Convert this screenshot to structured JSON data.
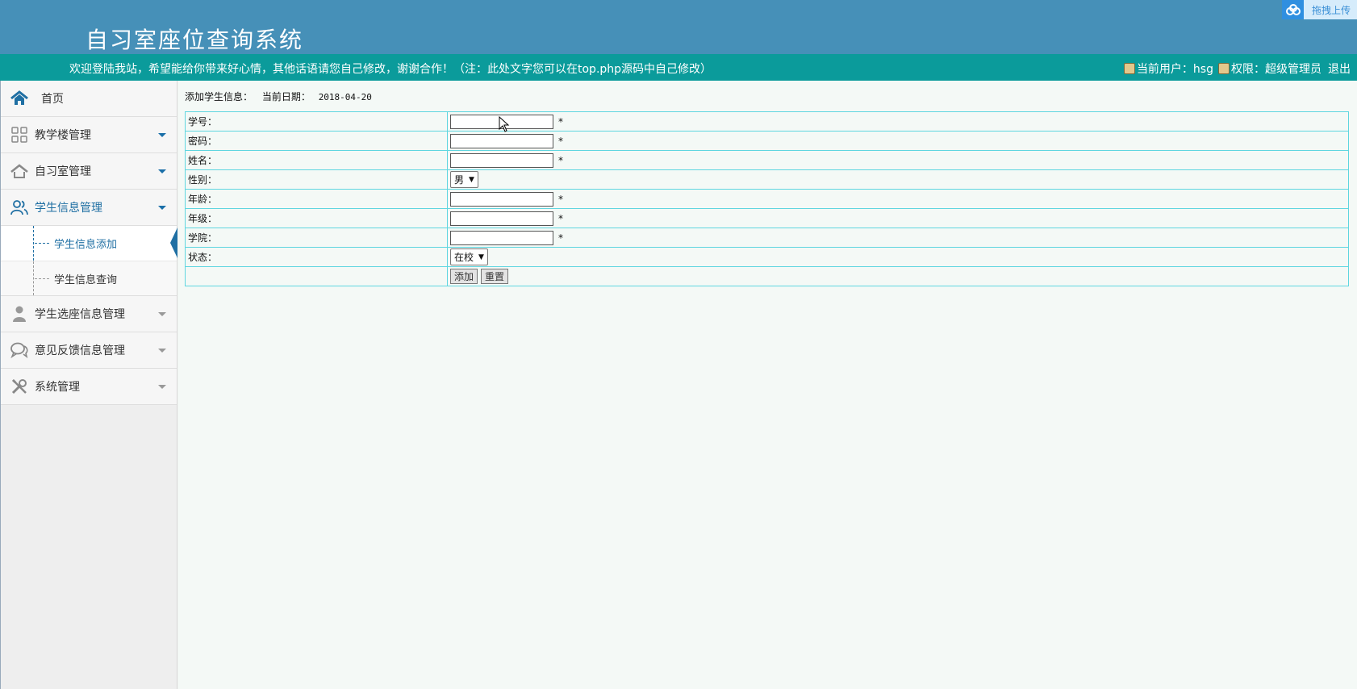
{
  "header": {
    "title": "自习室座位查询系统",
    "upload_label": "拖拽上传",
    "welcome": "欢迎登陆我站，希望能给你带来好心情，其他话语请您自己修改，谢谢合作！（注：此处文字您可以在top.php源码中自己修改）",
    "current_user_label": "当前用户：hsg",
    "role_label": "权限：超级管理员",
    "logout_label": "退出"
  },
  "sidebar": {
    "home": "首页",
    "items": [
      {
        "label": "教学楼管理"
      },
      {
        "label": "自习室管理"
      },
      {
        "label": "学生信息管理"
      },
      {
        "label": "学生选座信息管理"
      },
      {
        "label": "意见反馈信息管理"
      },
      {
        "label": "系统管理"
      }
    ],
    "sub_items": [
      {
        "label": "学生信息添加"
      },
      {
        "label": "学生信息查询"
      }
    ]
  },
  "main": {
    "heading": "添加学生信息：",
    "date_label": "当前日期：",
    "date_value": "2018-04-20",
    "form": {
      "fields": [
        {
          "label": "学号：",
          "value": "",
          "required": "*"
        },
        {
          "label": "密码：",
          "value": "",
          "required": "*"
        },
        {
          "label": "姓名：",
          "value": "",
          "required": "*"
        },
        {
          "label": "性别：",
          "selected": "男"
        },
        {
          "label": "年龄：",
          "value": "",
          "required": "*"
        },
        {
          "label": "年级：",
          "value": "",
          "required": "*"
        },
        {
          "label": "学院：",
          "value": "",
          "required": "*"
        },
        {
          "label": "状态：",
          "selected": "在校"
        }
      ],
      "submit_label": "添加",
      "reset_label": "重置"
    }
  },
  "colors": {
    "header_bg": "#4690b8",
    "welcome_bg": "#0b9b9b",
    "accent": "#1f6fa3",
    "table_border": "#5fd6e0"
  }
}
